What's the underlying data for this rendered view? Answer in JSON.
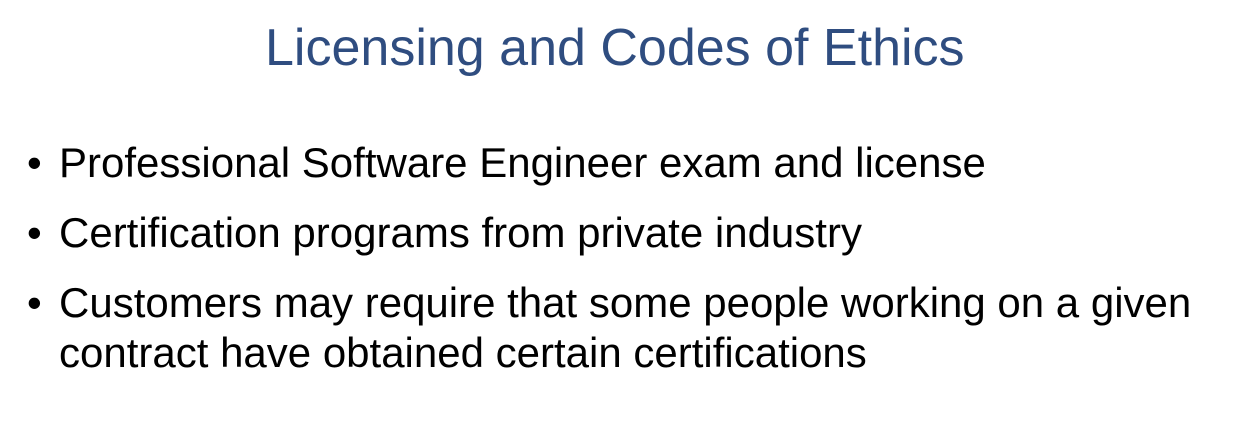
{
  "slide": {
    "title": "Licensing and Codes of Ethics",
    "bullet_glyph": "•",
    "bullets": [
      {
        "text": "Professional Software Engineer exam and license"
      },
      {
        "text": "Certification programs from private industry"
      },
      {
        "text": "Customers may require that some people working on a given contract have obtained certain certifications"
      }
    ]
  },
  "colors": {
    "title": "#2f4d80",
    "body_text": "#000000",
    "background": "#ffffff"
  }
}
